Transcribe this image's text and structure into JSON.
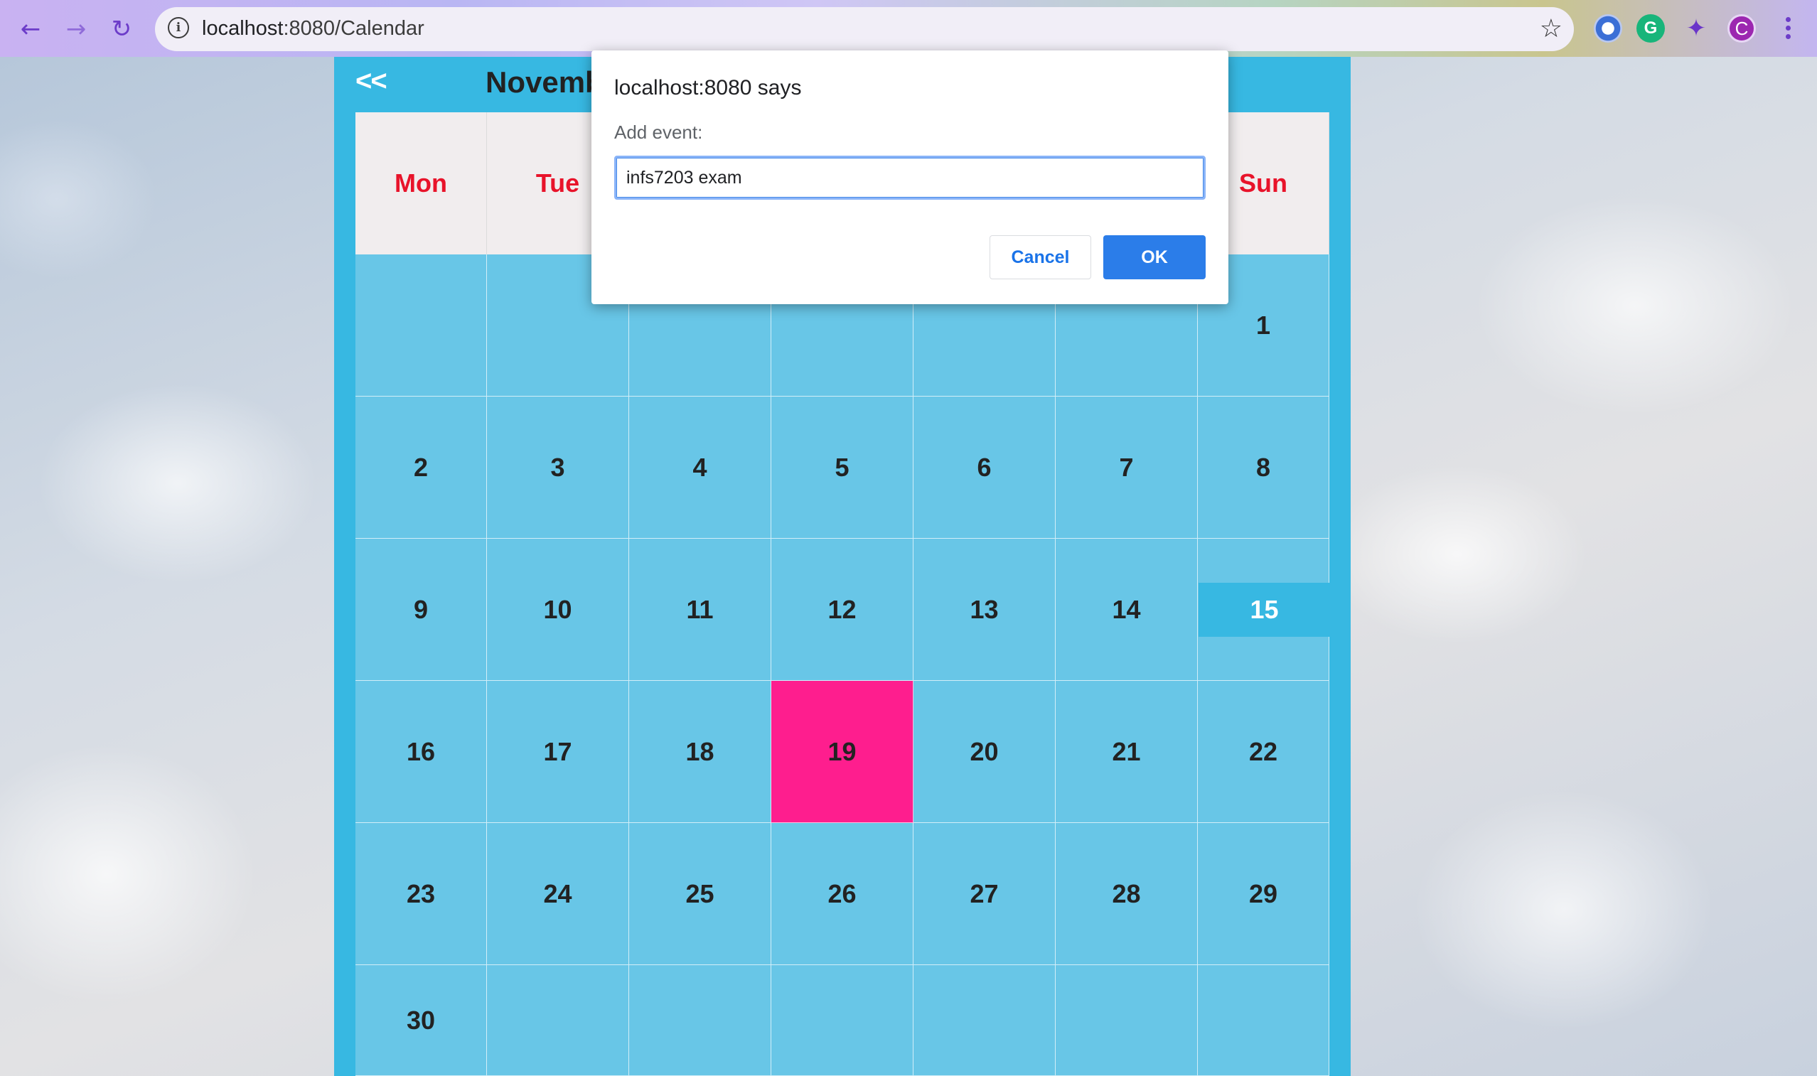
{
  "browser": {
    "url_host": "localhost",
    "url_path": ":8080/Calendar",
    "extensions": [
      {
        "name": "extension-orb-icon"
      },
      {
        "name": "grammarly-icon",
        "label": "G"
      },
      {
        "name": "puzzle-extensions-icon"
      },
      {
        "name": "profile-avatar",
        "label": "C"
      }
    ]
  },
  "calendar": {
    "prev_label": "<<",
    "month_title": "Novemb",
    "weekdays": [
      "Mon",
      "Tue",
      "",
      "",
      "",
      "",
      "Sun"
    ],
    "weeks": [
      [
        "",
        "",
        "",
        "",
        "",
        "",
        "1"
      ],
      [
        "2",
        "3",
        "4",
        "5",
        "6",
        "7",
        "8"
      ],
      [
        "9",
        "10",
        "11",
        "12",
        "13",
        "14",
        ""
      ],
      [
        "16",
        "17",
        "18",
        "19",
        "20",
        "21",
        "22"
      ],
      [
        "23",
        "24",
        "25",
        "26",
        "27",
        "28",
        "29"
      ],
      [
        "30",
        "",
        "",
        "",
        "",
        "",
        ""
      ]
    ],
    "today": "15",
    "selected": "19",
    "colors": {
      "frame": "#37b8e2",
      "weekday_text": "#e8132a",
      "selected": "#fe1e8e"
    }
  },
  "dialog": {
    "title": "localhost:8080 says",
    "message": "Add event:",
    "input_value": "infs7203 exam",
    "cancel_label": "Cancel",
    "ok_label": "OK"
  }
}
